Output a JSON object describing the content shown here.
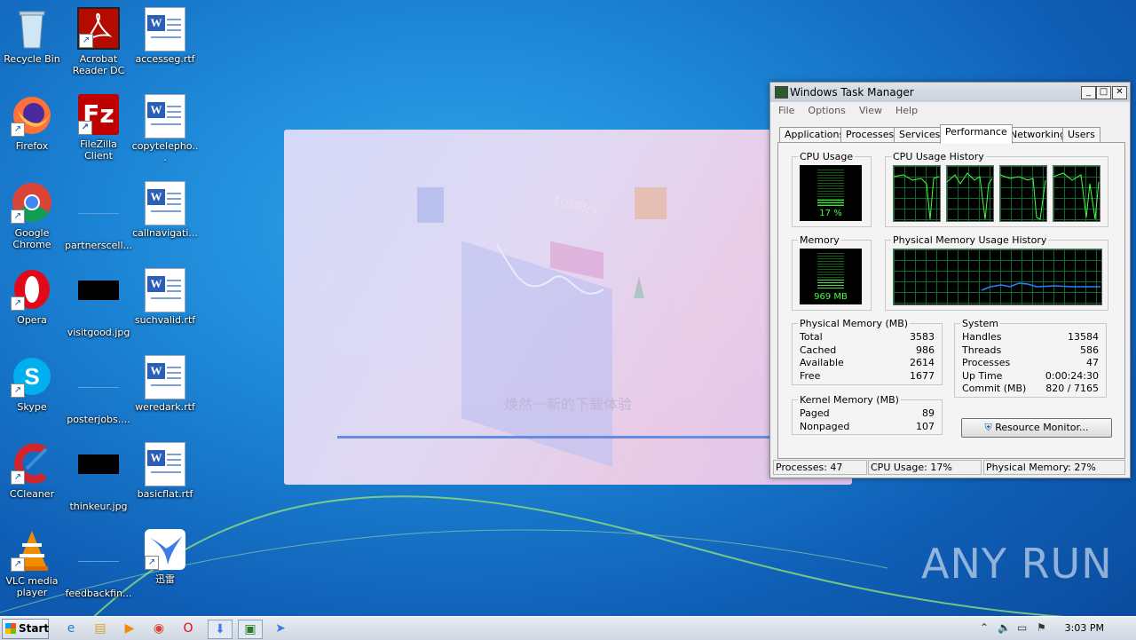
{
  "desktop": {
    "icons": [
      {
        "label": "Recycle Bin"
      },
      {
        "label": "Acrobat Reader DC"
      },
      {
        "label": "accesseg.rtf"
      },
      {
        "label": "Firefox"
      },
      {
        "label": "FileZilla Client"
      },
      {
        "label": "copytelepho..."
      },
      {
        "label": "Google Chrome"
      },
      {
        "label": "partnerscell..."
      },
      {
        "label": "callnavigati..."
      },
      {
        "label": "Opera"
      },
      {
        "label": "visitgood.jpg"
      },
      {
        "label": "suchvalid.rtf"
      },
      {
        "label": "Skype"
      },
      {
        "label": "posterjobs...."
      },
      {
        "label": "weredark.rtf"
      },
      {
        "label": "CCleaner"
      },
      {
        "label": "thinkeur.jpg"
      },
      {
        "label": "basicflat.rtf"
      },
      {
        "label": "VLC media player"
      },
      {
        "label": "feedbackfin..."
      },
      {
        "label": "迅雷"
      }
    ]
  },
  "splash": {
    "badge": "10MB/s",
    "caption": "焕然一新的下载体验"
  },
  "task_manager": {
    "title": "Windows Task Manager",
    "menu": [
      "File",
      "Options",
      "View",
      "Help"
    ],
    "tabs": [
      "Applications",
      "Processes",
      "Services",
      "Performance",
      "Networking",
      "Users"
    ],
    "active_tab": "Performance",
    "cpu_usage": {
      "label": "CPU Usage",
      "value": "17 %",
      "percent": 17
    },
    "cpu_history": {
      "label": "CPU Usage History"
    },
    "memory": {
      "label": "Memory",
      "value": "969 MB",
      "fraction": 0.27
    },
    "memory_history": {
      "label": "Physical Memory Usage History"
    },
    "physical_memory": {
      "label": "Physical Memory (MB)",
      "rows": [
        {
          "k": "Total",
          "v": "3583"
        },
        {
          "k": "Cached",
          "v": "986"
        },
        {
          "k": "Available",
          "v": "2614"
        },
        {
          "k": "Free",
          "v": "1677"
        }
      ]
    },
    "system": {
      "label": "System",
      "rows": [
        {
          "k": "Handles",
          "v": "13584"
        },
        {
          "k": "Threads",
          "v": "586"
        },
        {
          "k": "Processes",
          "v": "47"
        },
        {
          "k": "Up Time",
          "v": "0:00:24:30"
        },
        {
          "k": "Commit (MB)",
          "v": "820 / 7165"
        }
      ]
    },
    "kernel_memory": {
      "label": "Kernel Memory (MB)",
      "rows": [
        {
          "k": "Paged",
          "v": "89"
        },
        {
          "k": "Nonpaged",
          "v": "107"
        }
      ]
    },
    "resource_monitor_label": "Resource Monitor...",
    "status": {
      "processes": "Processes: 47",
      "cpu": "CPU Usage: 17%",
      "memory": "Physical Memory: 27%"
    }
  },
  "taskbar": {
    "start_label": "Start",
    "clock": "3:03 PM"
  },
  "watermark": "ANY RUN"
}
